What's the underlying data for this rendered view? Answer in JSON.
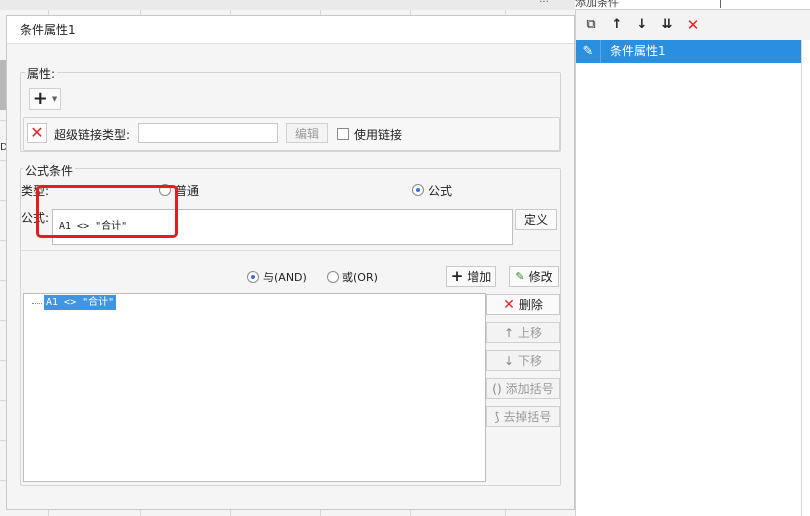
{
  "dialog": {
    "title": "条件属性1",
    "properties_label": "属性:",
    "add_symbol": "+",
    "hyperlink_type_label": "超级链接类型:",
    "hyperlink_type_value": "",
    "edit_button": "编辑",
    "use_link_label": "使用链接",
    "formula_condition_label": "公式条件",
    "type_label": "类型:",
    "type_options": [
      "普通",
      "公式"
    ],
    "type_selected": "公式",
    "formula_label": "公式:",
    "formula_value": "A1 <> \"合计\"",
    "define_button": "定义",
    "logic_and": "与(AND)",
    "logic_or": "或(OR)",
    "logic_selected": "与(AND)",
    "add_button": "增加",
    "modify_button": "修改",
    "conditions": [
      "A1 <> \"合计\""
    ],
    "delete_button": "删除",
    "move_up_button": "上移",
    "move_down_button": "下移",
    "add_bracket_button": "添加括号",
    "remove_bracket_button": "去掉括号"
  },
  "right_panel": {
    "header_label": "添加条件",
    "items": [
      {
        "label": "条件属性1"
      }
    ]
  },
  "colors": {
    "highlight": "#e41e1e",
    "selection": "#2b8fe0",
    "delete_red": "#e02424"
  }
}
